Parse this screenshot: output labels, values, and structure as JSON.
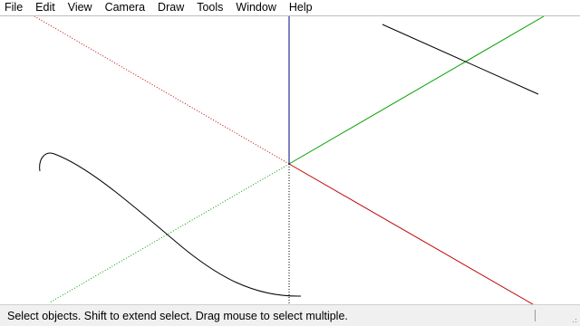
{
  "menubar": {
    "items": [
      {
        "label": "File"
      },
      {
        "label": "Edit"
      },
      {
        "label": "View"
      },
      {
        "label": "Camera"
      },
      {
        "label": "Draw"
      },
      {
        "label": "Tools"
      },
      {
        "label": "Window"
      },
      {
        "label": "Help"
      }
    ]
  },
  "statusbar": {
    "text": "Select objects. Shift to extend select. Drag mouse to select multiple."
  },
  "colors": {
    "red_axis": "#c00000",
    "green_axis": "#00a000",
    "blue_axis": "#000080",
    "geometry": "#000000"
  }
}
